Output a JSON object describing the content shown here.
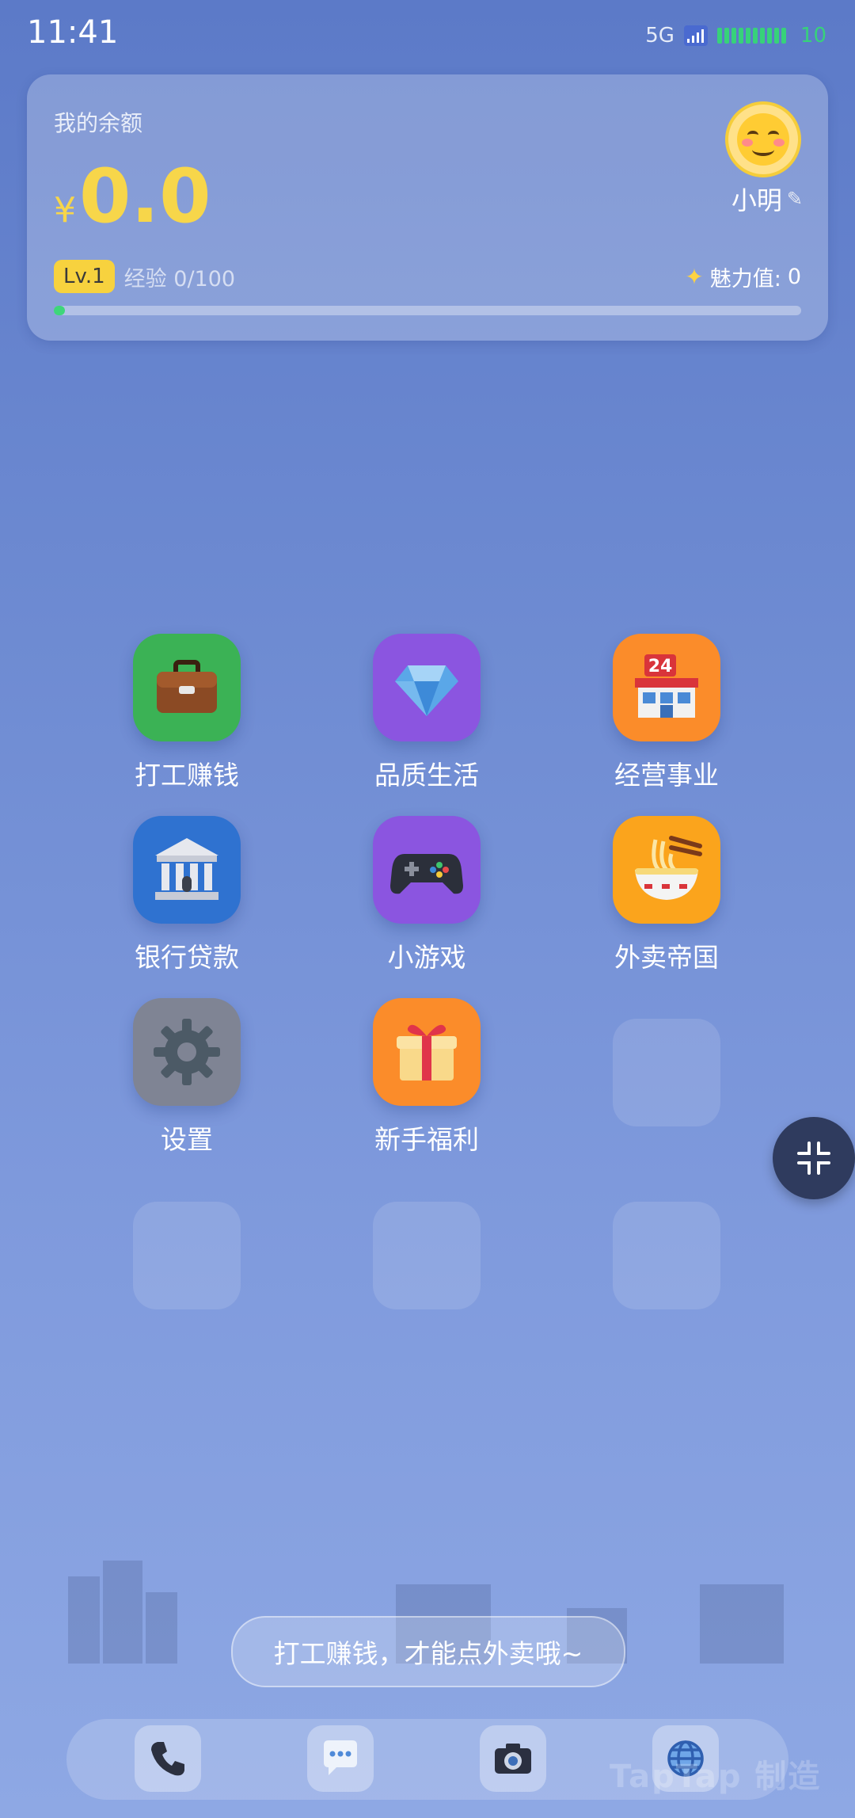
{
  "status_bar": {
    "time": "11:41",
    "network": "5G",
    "battery": "10"
  },
  "wallet": {
    "balance_label": "我的余额",
    "currency": "¥",
    "amount": "0.0",
    "username": "小明",
    "level": "Lv.1",
    "exp_label": "经验",
    "exp_value": "0/100",
    "exp_progress": 0.0,
    "charm_label": "魅力值:",
    "charm_value": "0"
  },
  "apps": [
    {
      "label": "打工赚钱",
      "icon": "briefcase-icon",
      "bg": "#3bb255"
    },
    {
      "label": "品质生活",
      "icon": "diamond-icon",
      "bg": "#8b55e0"
    },
    {
      "label": "经营事业",
      "icon": "convenience-store-icon",
      "bg": "#fb8c2a"
    },
    {
      "label": "银行贷款",
      "icon": "bank-icon",
      "bg": "#2f72d0"
    },
    {
      "label": "小游戏",
      "icon": "gamepad-icon",
      "bg": "#8b55e0"
    },
    {
      "label": "外卖帝国",
      "icon": "noodle-bowl-icon",
      "bg": "#fba41c"
    },
    {
      "label": "设置",
      "icon": "gear-icon",
      "bg": "#7f8494"
    },
    {
      "label": "新手福利",
      "icon": "gift-icon",
      "bg": "#fb8c2a"
    }
  ],
  "toast": "打工赚钱，才能点外卖哦~",
  "dock": [
    {
      "icon": "phone-icon"
    },
    {
      "icon": "chat-bubble-icon"
    },
    {
      "icon": "camera-icon"
    },
    {
      "icon": "globe-icon"
    }
  ],
  "floating_button": {
    "icon": "collapse-icon"
  },
  "watermark": "TapTap 制造"
}
